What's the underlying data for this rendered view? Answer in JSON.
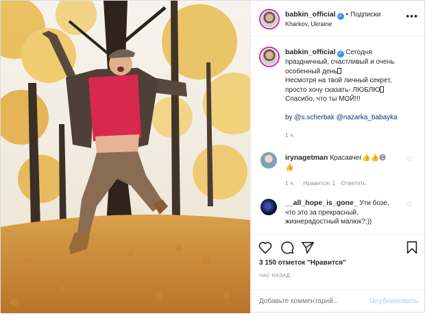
{
  "post": {
    "author": "babkin_official",
    "follow_label": "Подписки",
    "location": "Kharkov, Ukraine",
    "more_icon": "more-horizontal-icon"
  },
  "caption": {
    "author": "babkin_official",
    "text_1": "Сегодня",
    "text_2": "праздничный, счастливый и очень",
    "text_3": "особенный день",
    "text_4": "Несмотря на твой личный секрет,",
    "text_5": "просто хочу сказать- ЛЮБЛЮ",
    "text_6": "Спасибо, что ты МОЙ!!!",
    "by_prefix": "by",
    "mention_1": "@s.scherbak",
    "mention_2": "@nazarka_babayka",
    "time": "1 ч."
  },
  "comments": [
    {
      "author": "irynagetman",
      "text": "Красавчег👍👍😄",
      "text_2": "👍",
      "time": "1 ч.",
      "likes": "Нравится: 1",
      "reply": "Ответить"
    },
    {
      "author": "__all_hope_is_gone_",
      "text": "Ути бозе,",
      "text_2": "что это за прекрасный,",
      "text_3": "жизнерадостный малюк?:))"
    }
  ],
  "actions": {
    "likes_text": "3 150 отметок \"Нравится\"",
    "time_text": "ЧАС НАЗАД",
    "comment_placeholder": "Добавьте комментарий...",
    "publish_label": "Опубликовать"
  },
  "colors": {
    "link": "#00376b",
    "verified": "#3897f0",
    "publish_disabled": "#b2dffc"
  }
}
